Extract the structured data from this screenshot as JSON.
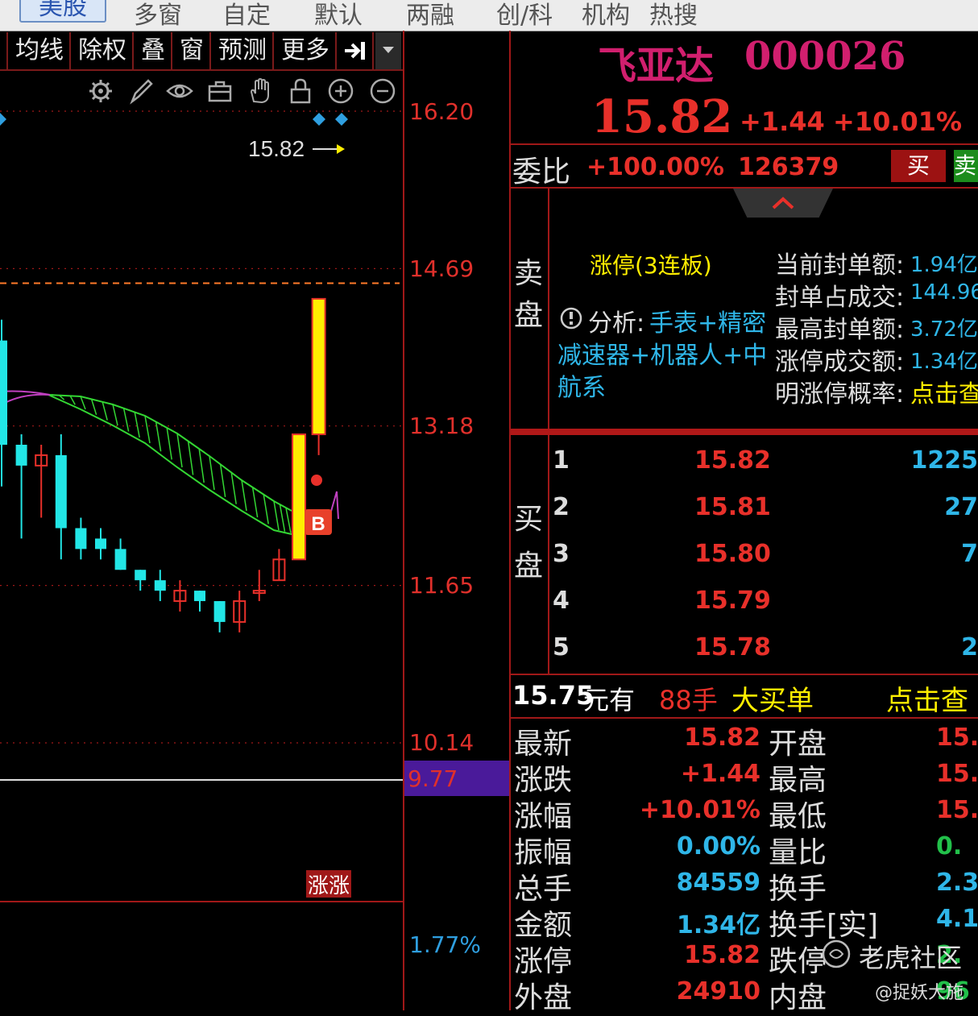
{
  "top_tabs": [
    {
      "label": "美股",
      "active": true
    },
    {
      "label": "多窗"
    },
    {
      "label": "自定"
    },
    {
      "label": "默认"
    },
    {
      "label": "两融"
    },
    {
      "label": "创/科"
    },
    {
      "label": "机构"
    },
    {
      "label": "热搜"
    }
  ],
  "chart_toolbar": [
    "均线",
    "除权",
    "叠",
    "窗",
    "预测",
    "更多"
  ],
  "chart_icons": [
    "gear-icon",
    "pen-icon",
    "eye-icon",
    "toolbox-icon",
    "hand-icon",
    "lock-icon",
    "zoom-in-icon",
    "zoom-out-icon"
  ],
  "price_axis": {
    "labels": [
      "16.20",
      "14.69",
      "13.18",
      "11.65",
      "10.14"
    ],
    "highlight": "9.77",
    "lower": "1.77%"
  },
  "chart": {
    "last_price_tag": "15.82",
    "signal_badge": "B",
    "limit_up_tag": "涨涨",
    "candles": [
      {
        "o": 13.0,
        "c": 14.0,
        "h": 14.2,
        "l": 12.6,
        "up": false
      },
      {
        "o": 13.0,
        "c": 12.8,
        "h": 13.1,
        "l": 12.1,
        "up": false
      },
      {
        "o": 12.9,
        "c": 12.8,
        "h": 13.0,
        "l": 12.3,
        "up": true
      },
      {
        "o": 12.9,
        "c": 12.2,
        "h": 13.1,
        "l": 11.9,
        "up": false
      },
      {
        "o": 12.2,
        "c": 12.0,
        "h": 12.3,
        "l": 11.9,
        "up": false
      },
      {
        "o": 12.1,
        "c": 12.0,
        "h": 12.2,
        "l": 11.9,
        "up": false
      },
      {
        "o": 12.0,
        "c": 11.8,
        "h": 12.1,
        "l": 11.8,
        "up": false
      },
      {
        "o": 11.8,
        "c": 11.7,
        "h": 11.8,
        "l": 11.6,
        "up": false
      },
      {
        "o": 11.7,
        "c": 11.6,
        "h": 11.8,
        "l": 11.5,
        "up": false
      },
      {
        "o": 11.5,
        "c": 11.6,
        "h": 11.7,
        "l": 11.4,
        "up": true
      },
      {
        "o": 11.6,
        "c": 11.5,
        "h": 11.6,
        "l": 11.4,
        "up": false
      },
      {
        "o": 11.5,
        "c": 11.3,
        "h": 11.5,
        "l": 11.2,
        "up": false
      },
      {
        "o": 11.3,
        "c": 11.5,
        "h": 11.6,
        "l": 11.2,
        "up": true
      },
      {
        "o": 11.6,
        "c": 11.6,
        "h": 11.8,
        "l": 11.5,
        "up": true
      },
      {
        "o": 11.7,
        "c": 11.9,
        "h": 12.0,
        "l": 11.7,
        "up": true
      },
      {
        "o": 11.9,
        "c": 13.1,
        "h": 13.1,
        "l": 11.9,
        "up": true
      },
      {
        "o": 13.1,
        "c": 14.4,
        "h": 14.4,
        "l": 12.9,
        "up": true
      }
    ]
  },
  "quote": {
    "name": "飞亚达",
    "code": "000026",
    "price": "15.82",
    "change": "+1.44",
    "change_pct": "+10.01%",
    "weibi_label": "委比",
    "weibi_pct": "+100.00%",
    "weibi_num": "126379",
    "buy_btn": "买",
    "sell_btn": "卖",
    "sell_side_label": "卖\n盘",
    "limit_status": "涨停(3连板)",
    "analysis_prefix": "分析:",
    "analysis_text_1": "手表+精密",
    "analysis_text_2": "减速器+机器人+中",
    "analysis_text_3": "航系",
    "seal_stats": [
      {
        "label": "当前封单额:",
        "value": "1.94亿"
      },
      {
        "label": "封单占成交:",
        "value": "144.96"
      },
      {
        "label": "最高封单额:",
        "value": "3.72亿"
      },
      {
        "label": "涨停成交额:",
        "value": "1.34亿"
      },
      {
        "label": "明涨停概率:",
        "value": "点击查"
      }
    ],
    "buy_side_label": "买\n盘",
    "bids": [
      {
        "level": "1",
        "price": "15.82",
        "vol": "1225"
      },
      {
        "level": "2",
        "price": "15.81",
        "vol": "27"
      },
      {
        "level": "3",
        "price": "15.80",
        "vol": "7"
      },
      {
        "level": "4",
        "price": "15.79",
        "vol": ""
      },
      {
        "level": "5",
        "price": "15.78",
        "vol": "2"
      }
    ],
    "big_order_price": "15.75",
    "big_order_text1": "元有",
    "big_order_lots": "88手",
    "big_order_text2": "大买单",
    "big_order_link": "点击查",
    "stats_left": [
      {
        "label": "最新",
        "value": "15.82"
      },
      {
        "label": "涨跌",
        "value": "+1.44"
      },
      {
        "label": "涨幅",
        "value": "+10.01%"
      },
      {
        "label": "振幅",
        "value": "0.00%"
      },
      {
        "label": "总手",
        "value": "84559"
      },
      {
        "label": "金额",
        "value": "1.34亿"
      },
      {
        "label": "涨停",
        "value": "15.82"
      },
      {
        "label": "外盘",
        "value": "24910"
      }
    ],
    "stats_right": [
      {
        "label": "开盘",
        "value": "15."
      },
      {
        "label": "最高",
        "value": "15."
      },
      {
        "label": "最低",
        "value": "15."
      },
      {
        "label": "量比",
        "value": "0."
      },
      {
        "label": "换手",
        "value": "2.3"
      },
      {
        "label": "换手[实]",
        "value": "4.1"
      },
      {
        "label": "跌停",
        "value": "2."
      },
      {
        "label": "内盘",
        "value": "96"
      }
    ],
    "watermark1": "老虎社区",
    "watermark2": "@捉妖大施"
  },
  "colors": {
    "up": "#e8302a",
    "down": "#22e6e6",
    "limit": "#ffee00",
    "axis": "#a01818",
    "ma_green": "#33d633",
    "ma_purple": "#c040c0"
  }
}
